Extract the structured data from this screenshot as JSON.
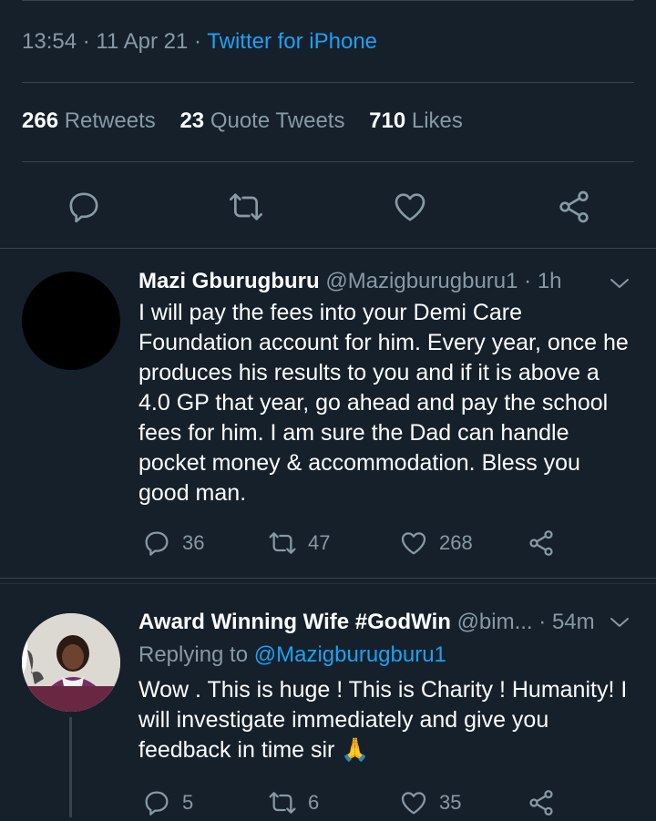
{
  "tweet": {
    "time": "13:54",
    "date": "11 Apr 21",
    "sep": "·",
    "source": "Twitter for iPhone",
    "stats": {
      "retweets_count": "266",
      "retweets_label": "Retweets",
      "quotes_count": "23",
      "quotes_label": "Quote Tweets",
      "likes_count": "710",
      "likes_label": "Likes"
    },
    "actions": [
      "reply-icon",
      "retweet-icon",
      "like-icon",
      "share-icon"
    ]
  },
  "replies": [
    {
      "name": "Mazi Gburugburu",
      "handle": "@Mazigburugburu1",
      "sep": "·",
      "time": "1h",
      "lines": [
        "I will pay the fees into your Demi Care",
        "Foundation account for him. Every year, once he",
        "produces his results to you and if it is above a",
        "4.0 GP that year, go ahead and pay the school",
        "fees for him. I am sure the Dad can handle",
        "pocket money & accommodation. Bless you",
        "good man."
      ],
      "reply_count": "36",
      "retweet_count": "47",
      "like_count": "268"
    },
    {
      "name": "Award Winning Wife #GodWin",
      "handle": "@bim...",
      "sep": "·",
      "time": "54m",
      "replying_to_label": "Replying to",
      "replying_to_handle": "@Mazigburugburu1",
      "lines": [
        "Wow . This is huge ! This is Charity ! Humanity! I",
        "will investigate immediately and give you",
        "feedback in time  sir 🙏"
      ],
      "reply_count": "5",
      "retweet_count": "6",
      "like_count": "35"
    }
  ],
  "colors": {
    "background": "#15202b",
    "muted": "#8899a6",
    "link": "#1da1f2",
    "divider": "#38444d"
  }
}
